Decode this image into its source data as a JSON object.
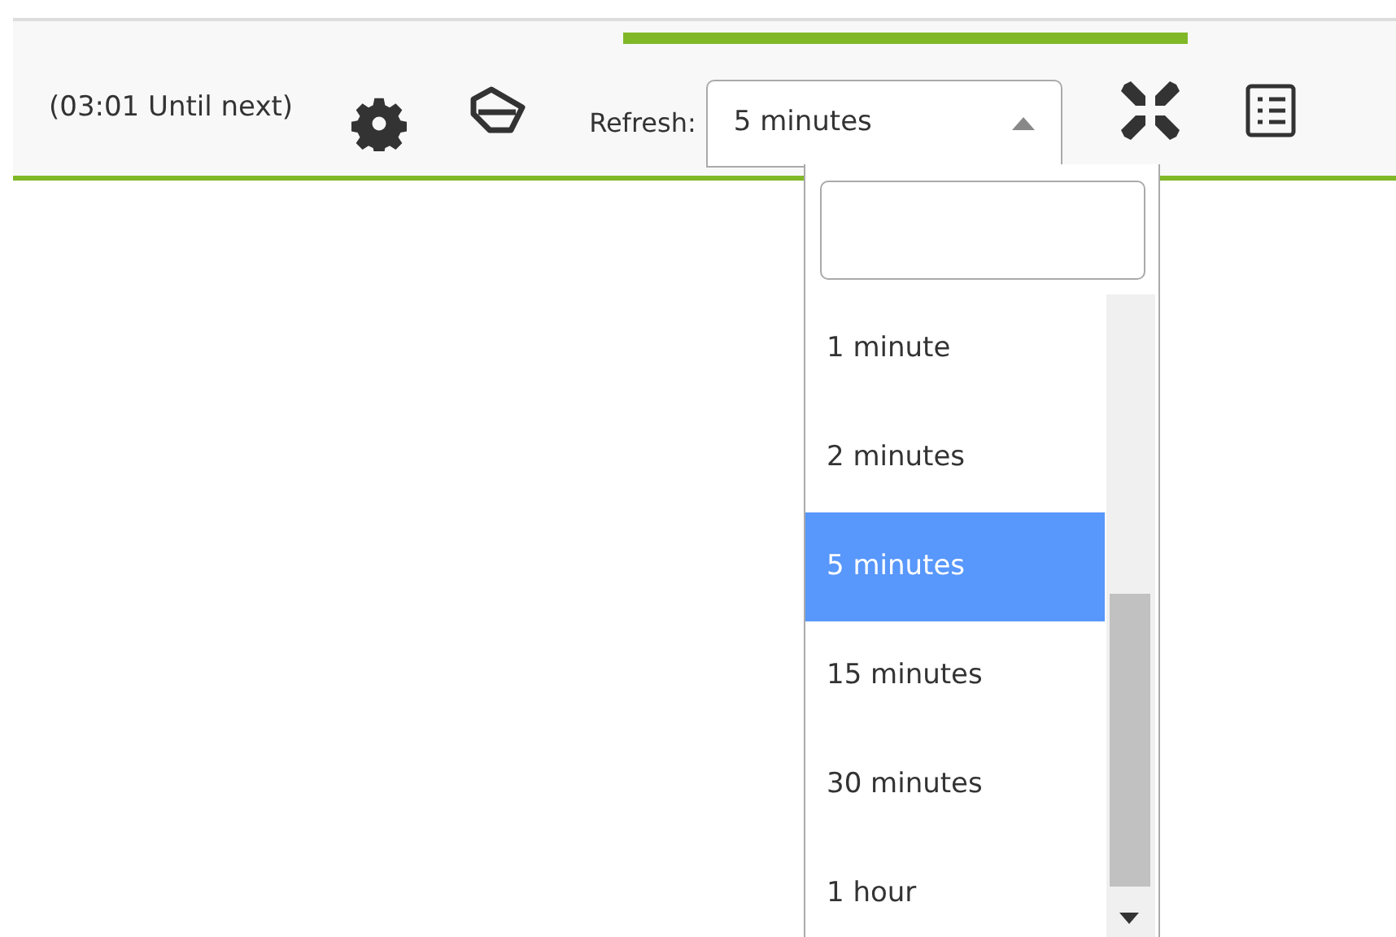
{
  "toolbar": {
    "progress": {
      "level": 0.73
    },
    "countdown": "(03:01 Until next)",
    "refresh_label": "Refresh:",
    "refresh_select": {
      "value": "5 minutes",
      "expanded": true
    }
  },
  "dropdown": {
    "options": [
      {
        "label": "1 minute",
        "selected": false
      },
      {
        "label": "2 minutes",
        "selected": false
      },
      {
        "label": "5 minutes",
        "selected": true
      },
      {
        "label": "15 minutes",
        "selected": false
      },
      {
        "label": "30 minutes",
        "selected": false
      },
      {
        "label": "1 hour",
        "selected": false
      }
    ]
  }
}
